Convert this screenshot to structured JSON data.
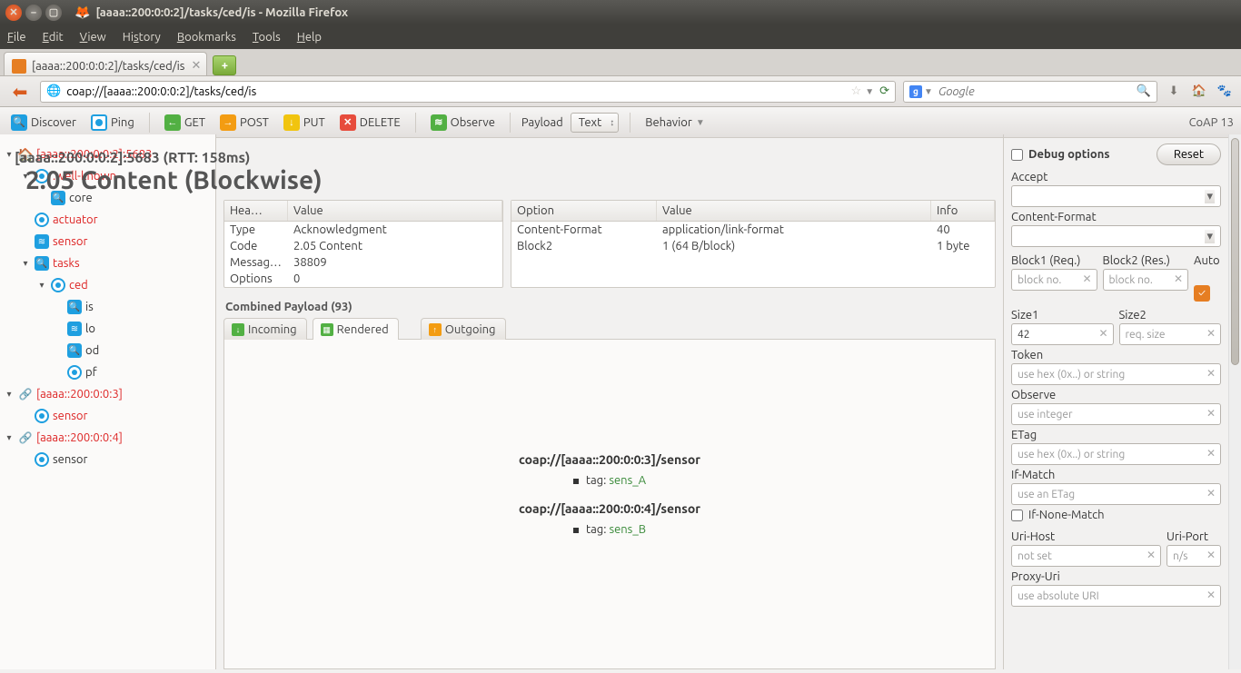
{
  "window": {
    "title": "[aaaa::200:0:0:2]/tasks/ced/is - Mozilla Firefox"
  },
  "menus": {
    "file": "File",
    "edit": "Edit",
    "view": "View",
    "history": "History",
    "bookmarks": "Bookmarks",
    "tools": "Tools",
    "help": "Help"
  },
  "tab": {
    "label": "[aaaa::200:0:0:2]/tasks/ced/is"
  },
  "url": "coap://[aaaa::200:0:0:2]/tasks/ced/is",
  "search": {
    "placeholder": "Google"
  },
  "toolbar": {
    "discover": "Discover",
    "ping": "Ping",
    "get": "GET",
    "post": "POST",
    "put": "PUT",
    "delete": "DELETE",
    "observe": "Observe",
    "payload_label": "Payload",
    "payload_combo": "Text",
    "behavior": "Behavior",
    "version": "CoAP 13"
  },
  "status": {
    "line1": "[aaaa::200:0:0:2]:5683 (RTT: 158ms)",
    "line2": "2.05 Content (Blockwise)"
  },
  "tree": [
    {
      "depth": 0,
      "twisty": "▾",
      "icon": "home",
      "label": "[aaaa::200:0:0:2]:5683",
      "red": true
    },
    {
      "depth": 1,
      "twisty": "▾",
      "icon": "target",
      "label": ".well-known",
      "red": true
    },
    {
      "depth": 2,
      "twisty": "",
      "icon": "blue",
      "label": "core",
      "red": false
    },
    {
      "depth": 1,
      "twisty": "",
      "icon": "target",
      "label": "actuator",
      "red": true
    },
    {
      "depth": 1,
      "twisty": "",
      "icon": "rss",
      "label": "sensor",
      "red": true
    },
    {
      "depth": 1,
      "twisty": "▾",
      "icon": "blue",
      "label": "tasks",
      "red": true
    },
    {
      "depth": 2,
      "twisty": "▾",
      "icon": "target",
      "label": "ced",
      "red": true
    },
    {
      "depth": 3,
      "twisty": "",
      "icon": "blue",
      "label": "is",
      "red": false
    },
    {
      "depth": 3,
      "twisty": "",
      "icon": "rss",
      "label": "lo",
      "red": false
    },
    {
      "depth": 3,
      "twisty": "",
      "icon": "blue",
      "label": "od",
      "red": false
    },
    {
      "depth": 3,
      "twisty": "",
      "icon": "target",
      "label": "pf",
      "red": false
    },
    {
      "depth": 0,
      "twisty": "▾",
      "icon": "link",
      "label": "[aaaa::200:0:0:3]",
      "red": true
    },
    {
      "depth": 1,
      "twisty": "",
      "icon": "target",
      "label": "sensor",
      "red": true
    },
    {
      "depth": 0,
      "twisty": "▾",
      "icon": "link",
      "label": "[aaaa::200:0:0:4]",
      "red": true
    },
    {
      "depth": 1,
      "twisty": "",
      "icon": "target",
      "label": "sensor",
      "red": false
    }
  ],
  "headers_table": {
    "cols": [
      "Hea…",
      "Value"
    ],
    "rows": [
      [
        "Type",
        "Acknowledgment"
      ],
      [
        "Code",
        "2.05 Content"
      ],
      [
        "Messag…",
        "38809"
      ],
      [
        "Options",
        "0"
      ]
    ]
  },
  "options_table": {
    "cols": [
      "Option",
      "Value",
      "Info"
    ],
    "rows": [
      [
        "Content-Format",
        "application/link-format",
        "40"
      ],
      [
        "Block2",
        "1 (64 B/block)",
        "1 byte"
      ]
    ]
  },
  "payload": {
    "title": "Combined Payload (93)",
    "tabs": {
      "incoming": "Incoming",
      "rendered": "Rendered",
      "outgoing": "Outgoing"
    },
    "links": [
      {
        "uri": "coap://[aaaa::200:0:0:3]/sensor",
        "tag": "sens_A"
      },
      {
        "uri": "coap://[aaaa::200:0:0:4]/sensor",
        "tag": "sens_B"
      }
    ]
  },
  "right": {
    "debug": "Debug options",
    "reset": "Reset",
    "accept": "Accept",
    "cformat": "Content-Format",
    "block1": "Block1 (Req.)",
    "block2": "Block2 (Res.)",
    "auto": "Auto",
    "blockno_ph": "block no.",
    "size1": "Size1",
    "size2": "Size2",
    "size1_val": "42",
    "size2_ph": "req. size",
    "token": "Token",
    "token_ph": "use hex (0x..) or string",
    "observe": "Observe",
    "observe_ph": "use integer",
    "etag": "ETag",
    "etag_ph": "use hex (0x..) or string",
    "ifmatch": "If-Match",
    "ifmatch_ph": "use an ETag",
    "ifnone": "If-None-Match",
    "urihost": "Uri-Host",
    "urihost_ph": "not set",
    "uriport": "Uri-Port",
    "uriport_ph": "n/s",
    "proxyuri": "Proxy-Uri",
    "proxyuri_ph": "use absolute URI"
  }
}
